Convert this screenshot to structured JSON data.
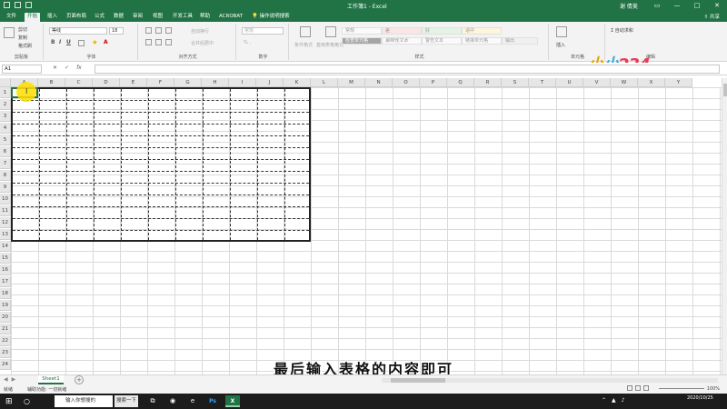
{
  "window": {
    "title": "工作簿1 - Excel",
    "user": "谢 倩美"
  },
  "ribbon_tabs": [
    "文件",
    "开始",
    "插入",
    "页面布局",
    "公式",
    "数据",
    "审阅",
    "视图",
    "开发工具",
    "帮助",
    "ACROBAT",
    "操作说明搜索"
  ],
  "share_label": "共享",
  "clipboard": {
    "cut": "剪切",
    "copy": "复制",
    "painter": "格式刷",
    "label": "剪贴板"
  },
  "font": {
    "name": "等线",
    "size": "18",
    "label": "字体"
  },
  "alignment": {
    "wrap": "自动换行",
    "merge": "合并后居中",
    "label": "对齐方式"
  },
  "number": {
    "format": "常规",
    "label": "数字"
  },
  "styles": {
    "conditional": "条件格式",
    "table_format": "套用表格格式",
    "cells": [
      "常规",
      "差",
      "好",
      "适中",
      "检查单元格",
      "解释性文本",
      "警告文本",
      "链接单元格",
      "输出"
    ],
    "label": "样式"
  },
  "cells_group": {
    "insert": "插入",
    "delete": "删除",
    "format": "格式",
    "label": "单元格"
  },
  "editing": {
    "autosum": "自动求和",
    "label": "编辑"
  },
  "logo": [
    "小",
    "小",
    "234"
  ],
  "formula_bar": {
    "name_box": "A1",
    "fx": "fx",
    "value": ""
  },
  "columns": [
    "A",
    "B",
    "C",
    "D",
    "E",
    "F",
    "G",
    "H",
    "I",
    "J",
    "K",
    "L",
    "M",
    "N",
    "O",
    "P",
    "Q",
    "R",
    "S",
    "T",
    "U",
    "V",
    "W",
    "X",
    "Y"
  ],
  "rows": [
    "1",
    "2",
    "3",
    "4",
    "5",
    "6",
    "7",
    "8",
    "9",
    "10",
    "11",
    "12",
    "13",
    "14",
    "15",
    "16",
    "17",
    "18",
    "19",
    "20",
    "21",
    "22",
    "23",
    "24"
  ],
  "sheet_tab": "Sheet1",
  "status": {
    "ready": "就绪",
    "accessibility": "辅助功能: 一切就绪",
    "zoom": "100%"
  },
  "subtitle": "最后输入表格的内容即可",
  "taskbar": {
    "search_placeholder": "输入你想搜的",
    "search_button": "搜索一下",
    "date": "2020/10/25"
  }
}
